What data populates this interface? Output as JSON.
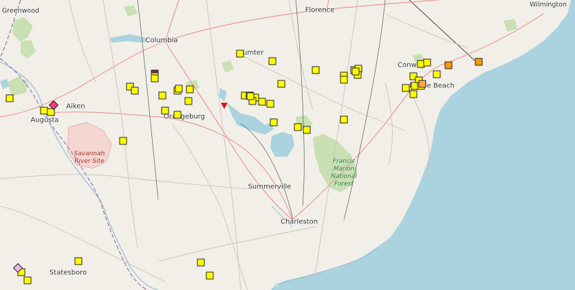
{
  "map": {
    "cities": [
      {
        "id": "greenwood",
        "label": "Greenwood"
      },
      {
        "id": "florence",
        "label": "Florence"
      },
      {
        "id": "wilmington",
        "label": "Wilmington"
      },
      {
        "id": "columbia",
        "label": "Columbia"
      },
      {
        "id": "sumter",
        "label": "Sumter"
      },
      {
        "id": "conway",
        "label": "Conway"
      },
      {
        "id": "myrtle-beach",
        "label": "Myrtle Beach"
      },
      {
        "id": "aiken",
        "label": "Aiken"
      },
      {
        "id": "augusta",
        "label": "Augusta"
      },
      {
        "id": "orangeburg",
        "label": "Orangeburg"
      },
      {
        "id": "summerville",
        "label": "Summerville"
      },
      {
        "id": "charleston",
        "label": "Charleston"
      },
      {
        "id": "statesboro",
        "label": "Statesboro"
      }
    ],
    "areas": [
      {
        "id": "savannah-river-site",
        "lines": [
          "Savannah",
          "River Site"
        ]
      },
      {
        "id": "francis-marion",
        "lines": [
          "Francis",
          "Marion",
          "National",
          "Forest"
        ]
      }
    ],
    "markers": {
      "yellow_count": 52,
      "orange_count": 3,
      "triangle_count": 1,
      "diamond_count": 2
    },
    "colors": {
      "land": "#f2efe9",
      "ocean": "#aad3df",
      "forest": "#c8e0b4",
      "marker_yellow": "#ffff00",
      "marker_orange": "#ff9900",
      "marker_triangle": "#e01010"
    }
  }
}
